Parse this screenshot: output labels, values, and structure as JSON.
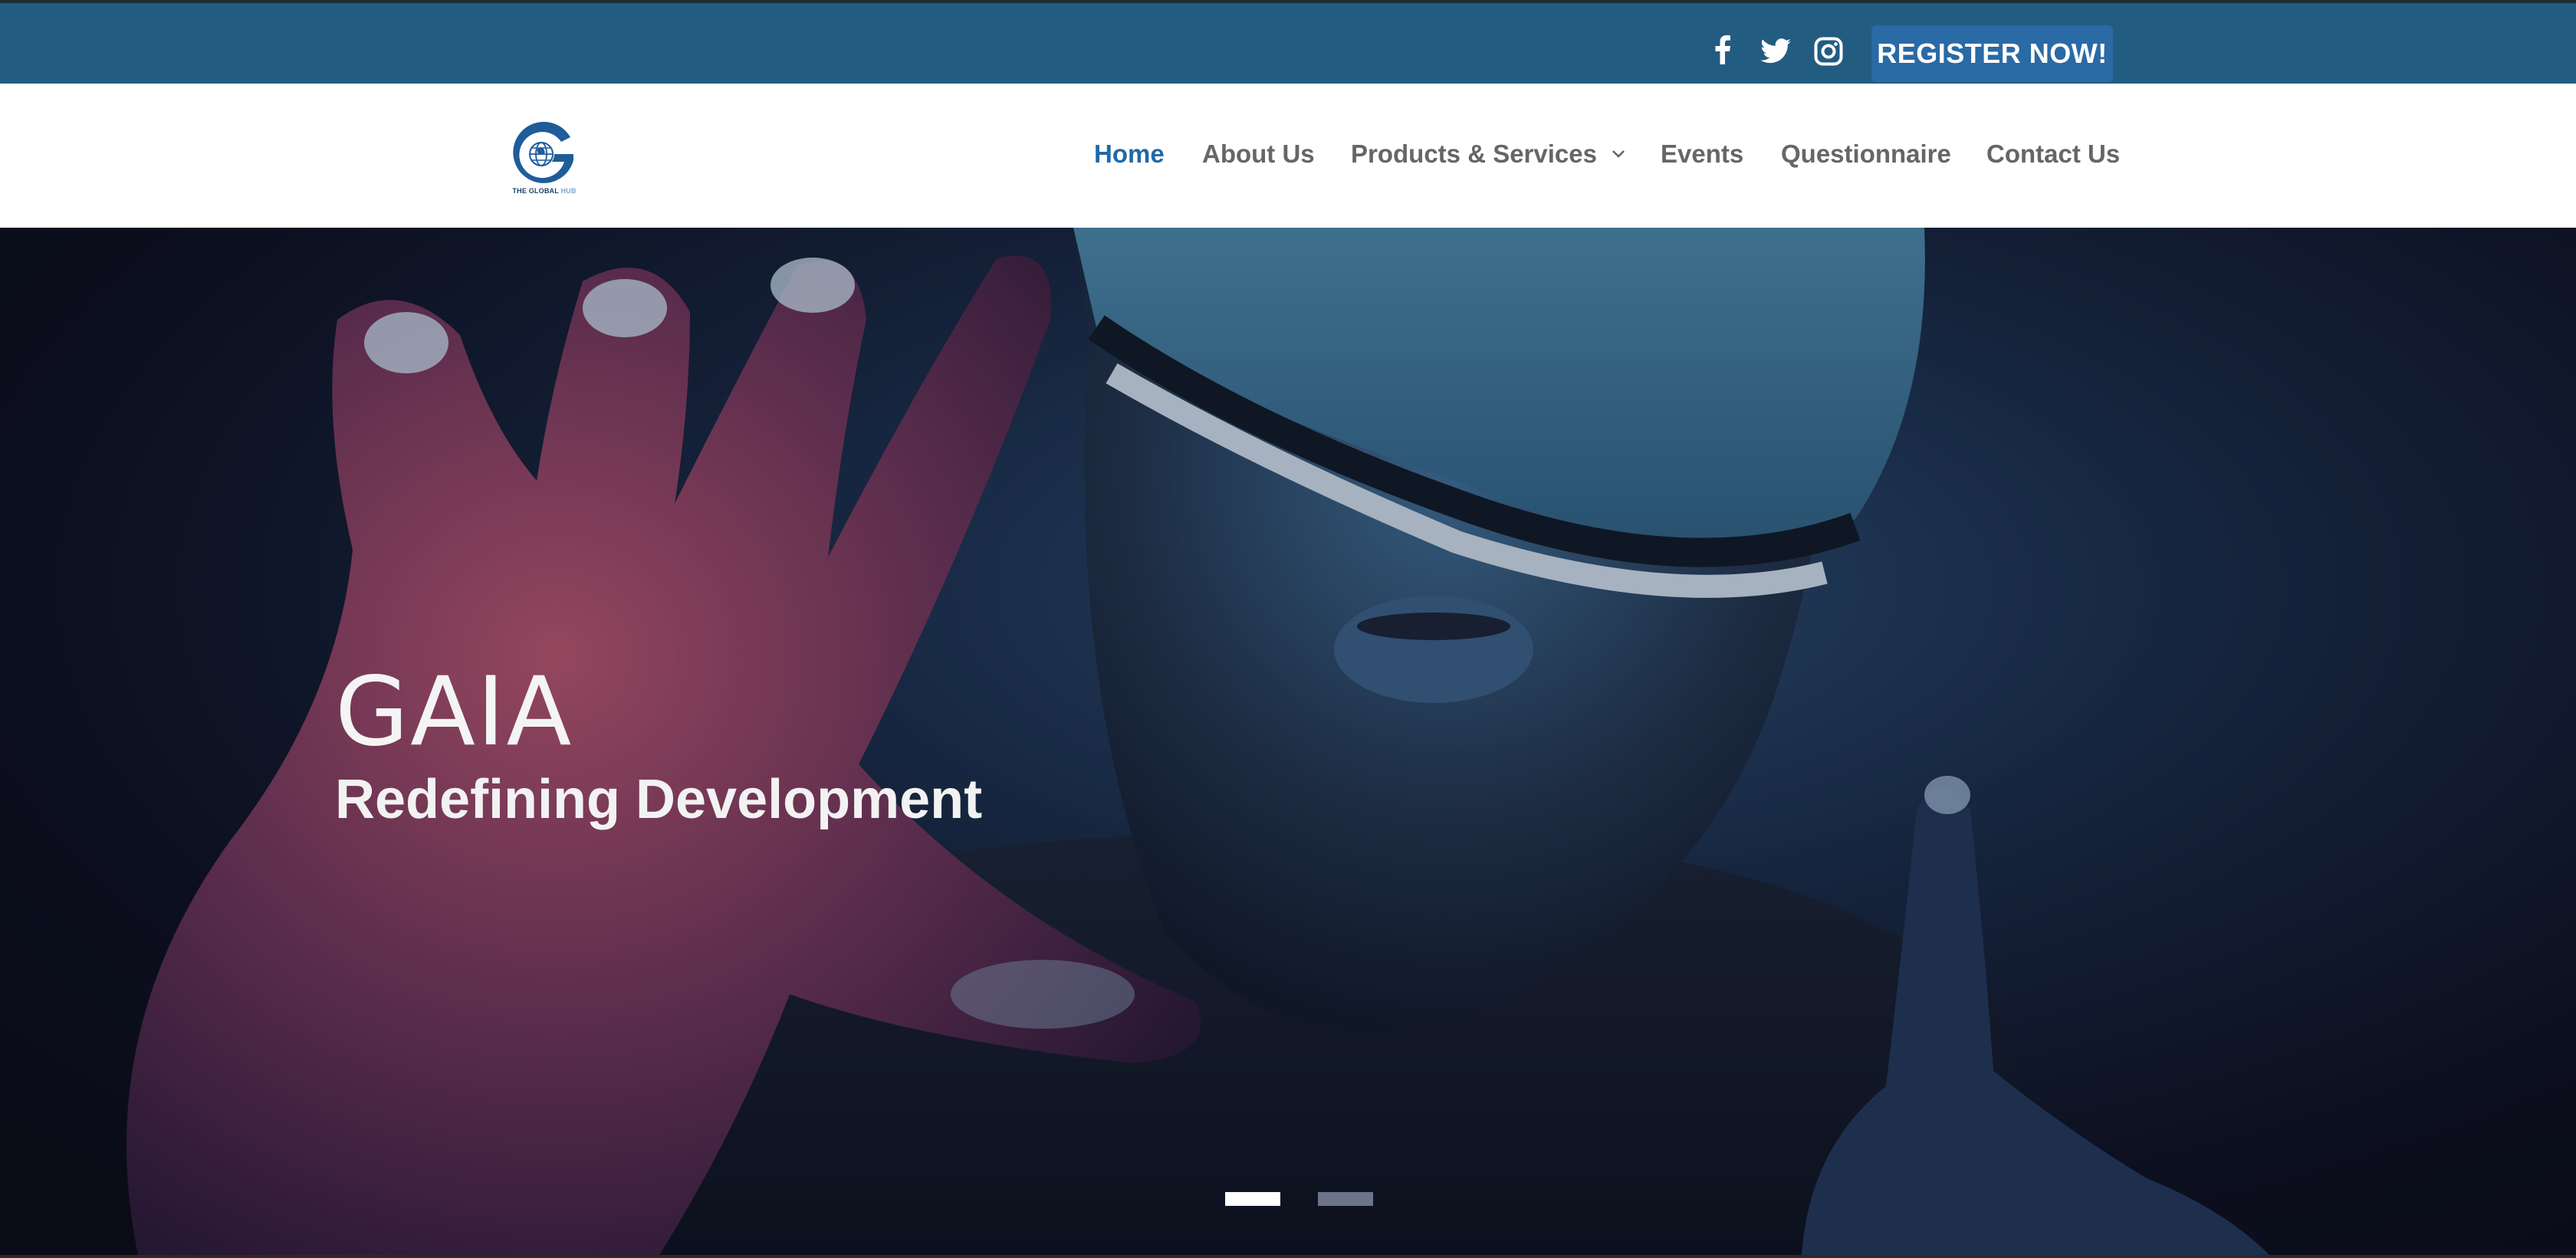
{
  "topbar": {
    "social_icons": [
      "facebook-icon",
      "twitter-icon",
      "instagram-icon"
    ],
    "register_label": "REGISTER NOW!",
    "background_color": "#235c81",
    "button_color": "#2a6aa5"
  },
  "logo": {
    "text_main": "THE GLOBAL",
    "text_accent": "HUB",
    "icon": "globe-g-logo"
  },
  "nav": {
    "items": [
      {
        "label": "Home",
        "active": true
      },
      {
        "label": "About Us",
        "active": false
      },
      {
        "label": "Products & Services",
        "active": false,
        "has_dropdown": true
      },
      {
        "label": "Events",
        "active": false
      },
      {
        "label": "Questionnaire",
        "active": false
      },
      {
        "label": "Contact Us",
        "active": false
      }
    ],
    "active_color": "#2069a6",
    "text_color": "#666666"
  },
  "hero": {
    "title": "GAIA",
    "subtitle": "Redefining Development",
    "slides": 2,
    "active_slide": 1
  }
}
